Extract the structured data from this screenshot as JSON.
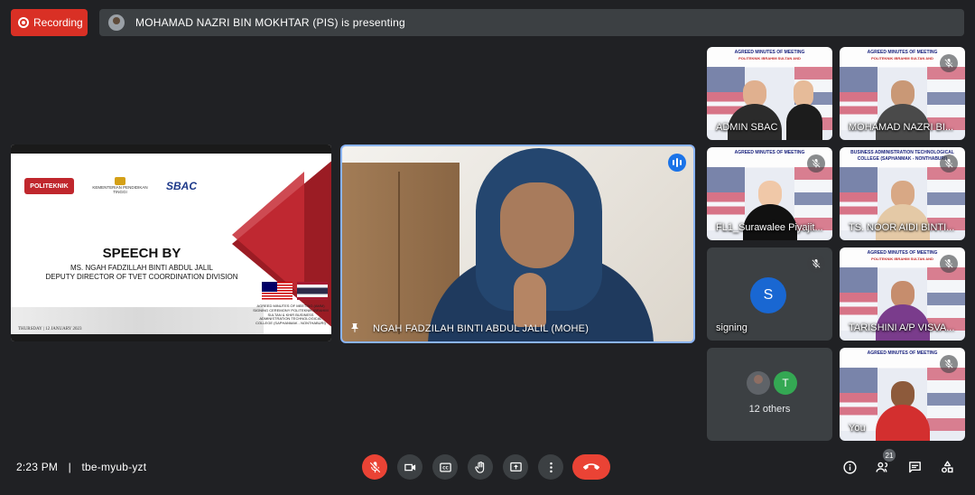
{
  "top_bar": {
    "recording_label": "Recording",
    "presenting_text": "MOHAMAD NAZRI BIN MOKHTAR (PIS) is presenting"
  },
  "slide": {
    "logo_politeknik": "POLITEKNIK",
    "logo_kpt": "KEMENTERIAN PENDIDIKAN TINGGI",
    "logo_sbac": "SBAC",
    "title": "SPEECH BY",
    "subtitle_line1": "MS. NGAH FADZILLAH BINTI ABDUL JALIL",
    "subtitle_line2": "DEPUTY DIRECTOR OF TVET COORDINATION DIVISION",
    "small_text": "AGREED MINUTES OF MEETING (AMM) SIGNING CEREMONY POLITEKNIK IBRAHIM SULTAN & KHIR BUSINESS ADMINISTRATION TECHNOLOGICAL COLLEGE (SAPHANMAK - NONTHABURI)",
    "date": "THURSDAY | 12 JANUARY 2023"
  },
  "main_speaker": {
    "name": "NGAH FADZILAH BINTI ABDUL JALIL (MOHE)"
  },
  "tile_header": {
    "line1": "AGREED MINUTES OF MEETING",
    "line2": "POLITEKNIK IBRAHIM SULTAN AND",
    "line3": "BUSINESS ADMINISTRATION TECHNOLOGICAL COLLEGE (SAPHANMAK - NONTHABURI)"
  },
  "participants": [
    {
      "name": "ADMIN SBAC"
    },
    {
      "name": "MOHAMAD NAZRI BI..."
    },
    {
      "name": "FL1_Surawalee Piyajit..."
    },
    {
      "name": "TS. NOOR AIDI BINTI..."
    },
    {
      "name": "signing",
      "initial": "S"
    },
    {
      "name": "TARISHINI A/P VISVA..."
    },
    {
      "label": "12 others",
      "initial": "T"
    },
    {
      "name": "You"
    }
  ],
  "bottom_bar": {
    "time": "2:23 PM",
    "separator": "|",
    "meeting_code": "tbe-myub-yzt",
    "people_count": "21"
  },
  "colors": {
    "background": "#202124",
    "recording": "#d93025",
    "end_call": "#ea4335",
    "active_speaker_border": "#8ab4f8"
  }
}
